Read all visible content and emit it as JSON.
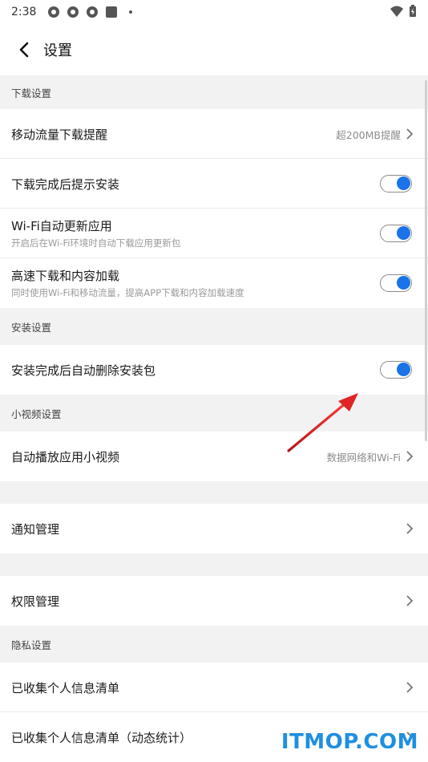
{
  "status": {
    "time": "2:38"
  },
  "header": {
    "title": "设置"
  },
  "sections": {
    "download": "下载设置",
    "install": "安装设置",
    "video": "小视频设置",
    "privacy": "隐私设置"
  },
  "rows": {
    "mobile_data": {
      "title": "移动流量下载提醒",
      "value": "超200MB提醒"
    },
    "prompt_install": {
      "title": "下载完成后提示安装",
      "toggle_on": true
    },
    "wifi_update": {
      "title": "Wi-Fi自动更新应用",
      "subtitle": "开启后在Wi-Fi环境时自动下载应用更新包",
      "toggle_on": true
    },
    "high_speed": {
      "title": "高速下载和内容加载",
      "subtitle": "同时使用Wi-Fi和移动流量，提高APP下载和内容加载速度",
      "toggle_on": true
    },
    "auto_delete": {
      "title": "安装完成后自动删除安装包",
      "toggle_on": true
    },
    "autoplay": {
      "title": "自动播放应用小视频",
      "value": "数据网络和Wi-Fi"
    },
    "notification": {
      "title": "通知管理"
    },
    "permission": {
      "title": "权限管理"
    },
    "collected_list": {
      "title": "已收集个人信息清单"
    },
    "collected_dynamic": {
      "title": "已收集个人信息清单（动态统计）"
    }
  },
  "watermark": "ITMOP.COM",
  "colors": {
    "accent": "#1a73e8",
    "annotation_arrow": "#e02424",
    "watermark": "#1f8fe0"
  }
}
